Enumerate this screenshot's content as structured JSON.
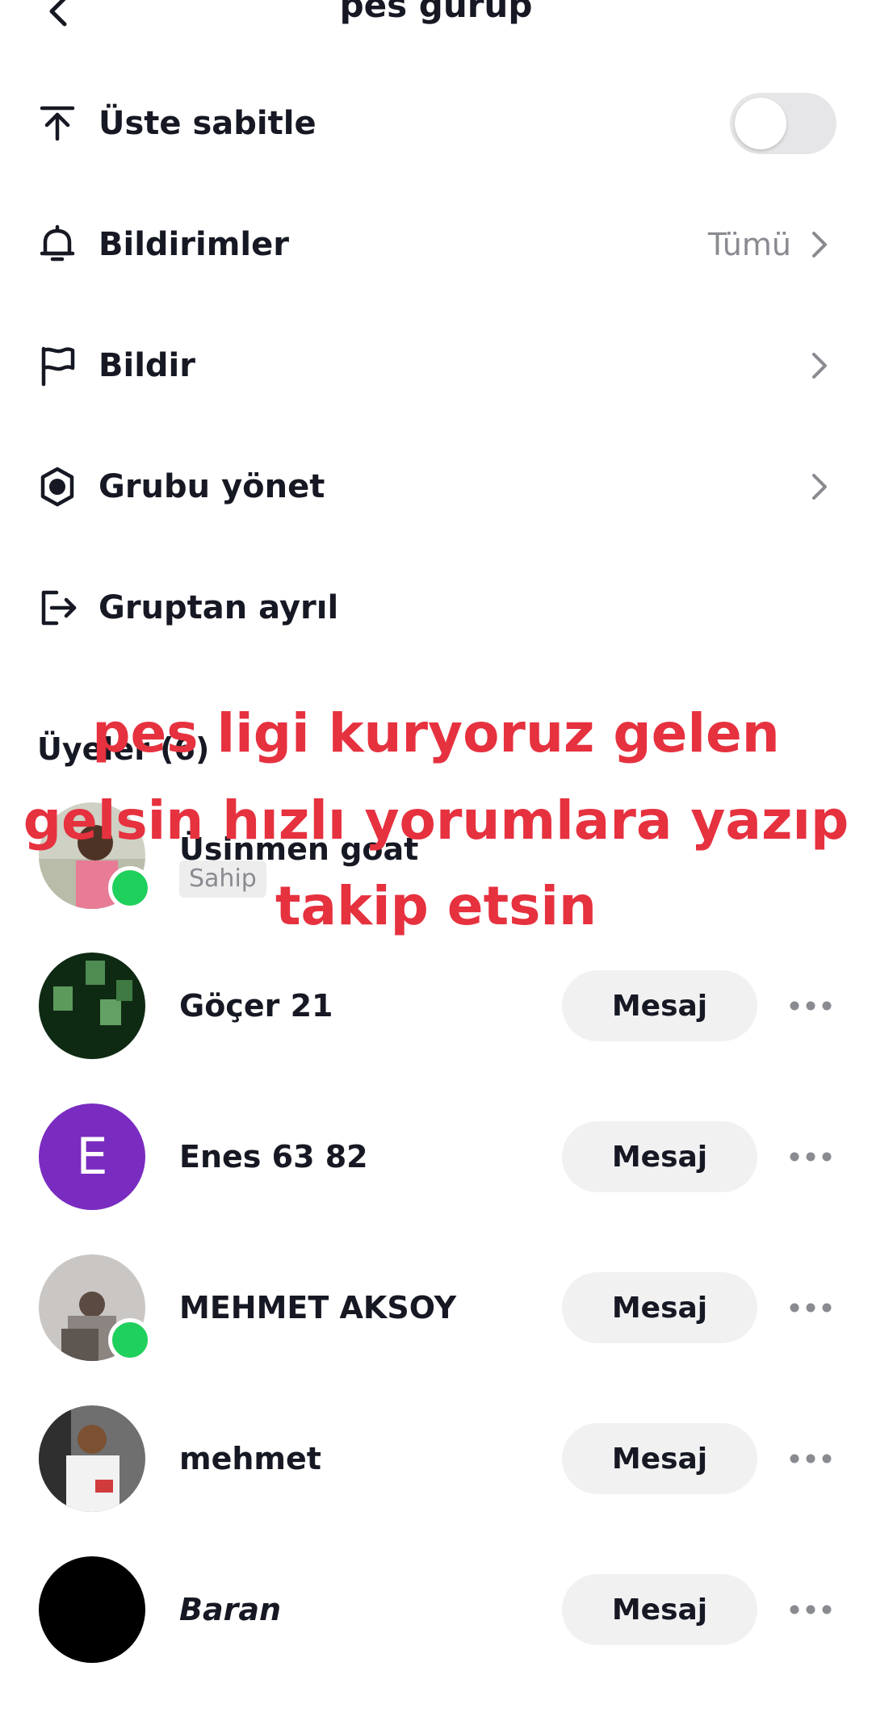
{
  "header": {
    "title": "pes gurup",
    "back_icon": "chevron-left-icon"
  },
  "settings": {
    "pin": {
      "label": "Üste sabitle",
      "icon": "pin-top-icon",
      "enabled": false
    },
    "notifications": {
      "label": "Bildirimler",
      "value": "Tümü",
      "icon": "bell-icon"
    },
    "report": {
      "label": "Bildir",
      "icon": "flag-icon"
    },
    "manage": {
      "label": "Grubu yönet",
      "icon": "gear-icon"
    },
    "leave": {
      "label": "Gruptan ayrıl",
      "icon": "exit-icon"
    }
  },
  "members": {
    "header": "Üyeler (6)",
    "owner_badge": "Sahip",
    "button_label": "Mesaj",
    "items": [
      {
        "name": "Üsinmen goat",
        "role": "Sahip",
        "online": true
      },
      {
        "name": "Göçer 21",
        "online": false
      },
      {
        "name": "Enes 63 82",
        "initial": "E",
        "online": false
      },
      {
        "name": "MEHMET AKSOY",
        "online": true
      },
      {
        "name": "mehmet",
        "online": false
      },
      {
        "name": "Baran",
        "online": false
      }
    ]
  },
  "overlay_caption": {
    "line1": "pes ligi kuryoruz gelen",
    "line2": "gelsin hızlı yorumlara yazıp",
    "line3": "takip etsin",
    "color": "#e6313f"
  },
  "colors": {
    "online": "#20d05c",
    "avatar_purple": "#7a2cc0",
    "button_bg": "#f1f1f2"
  }
}
